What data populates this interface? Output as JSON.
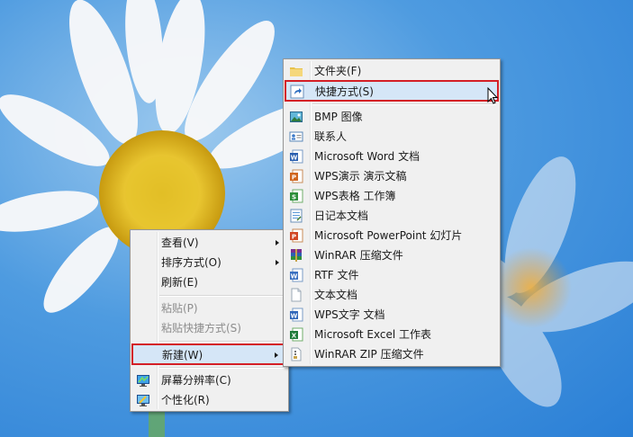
{
  "context_menu": {
    "items": [
      {
        "label": "查看(V)",
        "submenu": true
      },
      {
        "label": "排序方式(O)",
        "submenu": true
      },
      {
        "label": "刷新(E)"
      },
      {
        "label": "粘贴(P)",
        "disabled": true
      },
      {
        "label": "粘贴快捷方式(S)",
        "disabled": true
      },
      {
        "label": "新建(W)",
        "submenu": true,
        "highlighted": true
      },
      {
        "label": "屏幕分辨率(C)"
      },
      {
        "label": "个性化(R)"
      }
    ]
  },
  "new_submenu": {
    "items": [
      {
        "label": "文件夹(F)",
        "icon": "folder-icon"
      },
      {
        "label": "快捷方式(S)",
        "icon": "shortcut-icon",
        "highlighted": true
      },
      {
        "label": "BMP 图像",
        "icon": "bmp-image-icon"
      },
      {
        "label": "联系人",
        "icon": "contact-icon"
      },
      {
        "label": "Microsoft Word 文档",
        "icon": "word-document-icon"
      },
      {
        "label": "WPS演示 演示文稿",
        "icon": "wps-presentation-icon"
      },
      {
        "label": "WPS表格 工作簿",
        "icon": "wps-spreadsheet-icon"
      },
      {
        "label": "日记本文档",
        "icon": "journal-document-icon"
      },
      {
        "label": "Microsoft PowerPoint 幻灯片",
        "icon": "powerpoint-icon"
      },
      {
        "label": "WinRAR 压缩文件",
        "icon": "winrar-archive-icon"
      },
      {
        "label": "RTF 文件",
        "icon": "rtf-file-icon"
      },
      {
        "label": "文本文档",
        "icon": "text-document-icon"
      },
      {
        "label": "WPS文字 文档",
        "icon": "wps-writer-icon"
      },
      {
        "label": "Microsoft Excel 工作表",
        "icon": "excel-worksheet-icon"
      },
      {
        "label": "WinRAR ZIP 压缩文件",
        "icon": "winrar-zip-icon"
      }
    ]
  },
  "colors": {
    "highlight_border": "#d41f26",
    "menu_background": "#f0f0f0",
    "hover_background": "#d5e6f7"
  }
}
